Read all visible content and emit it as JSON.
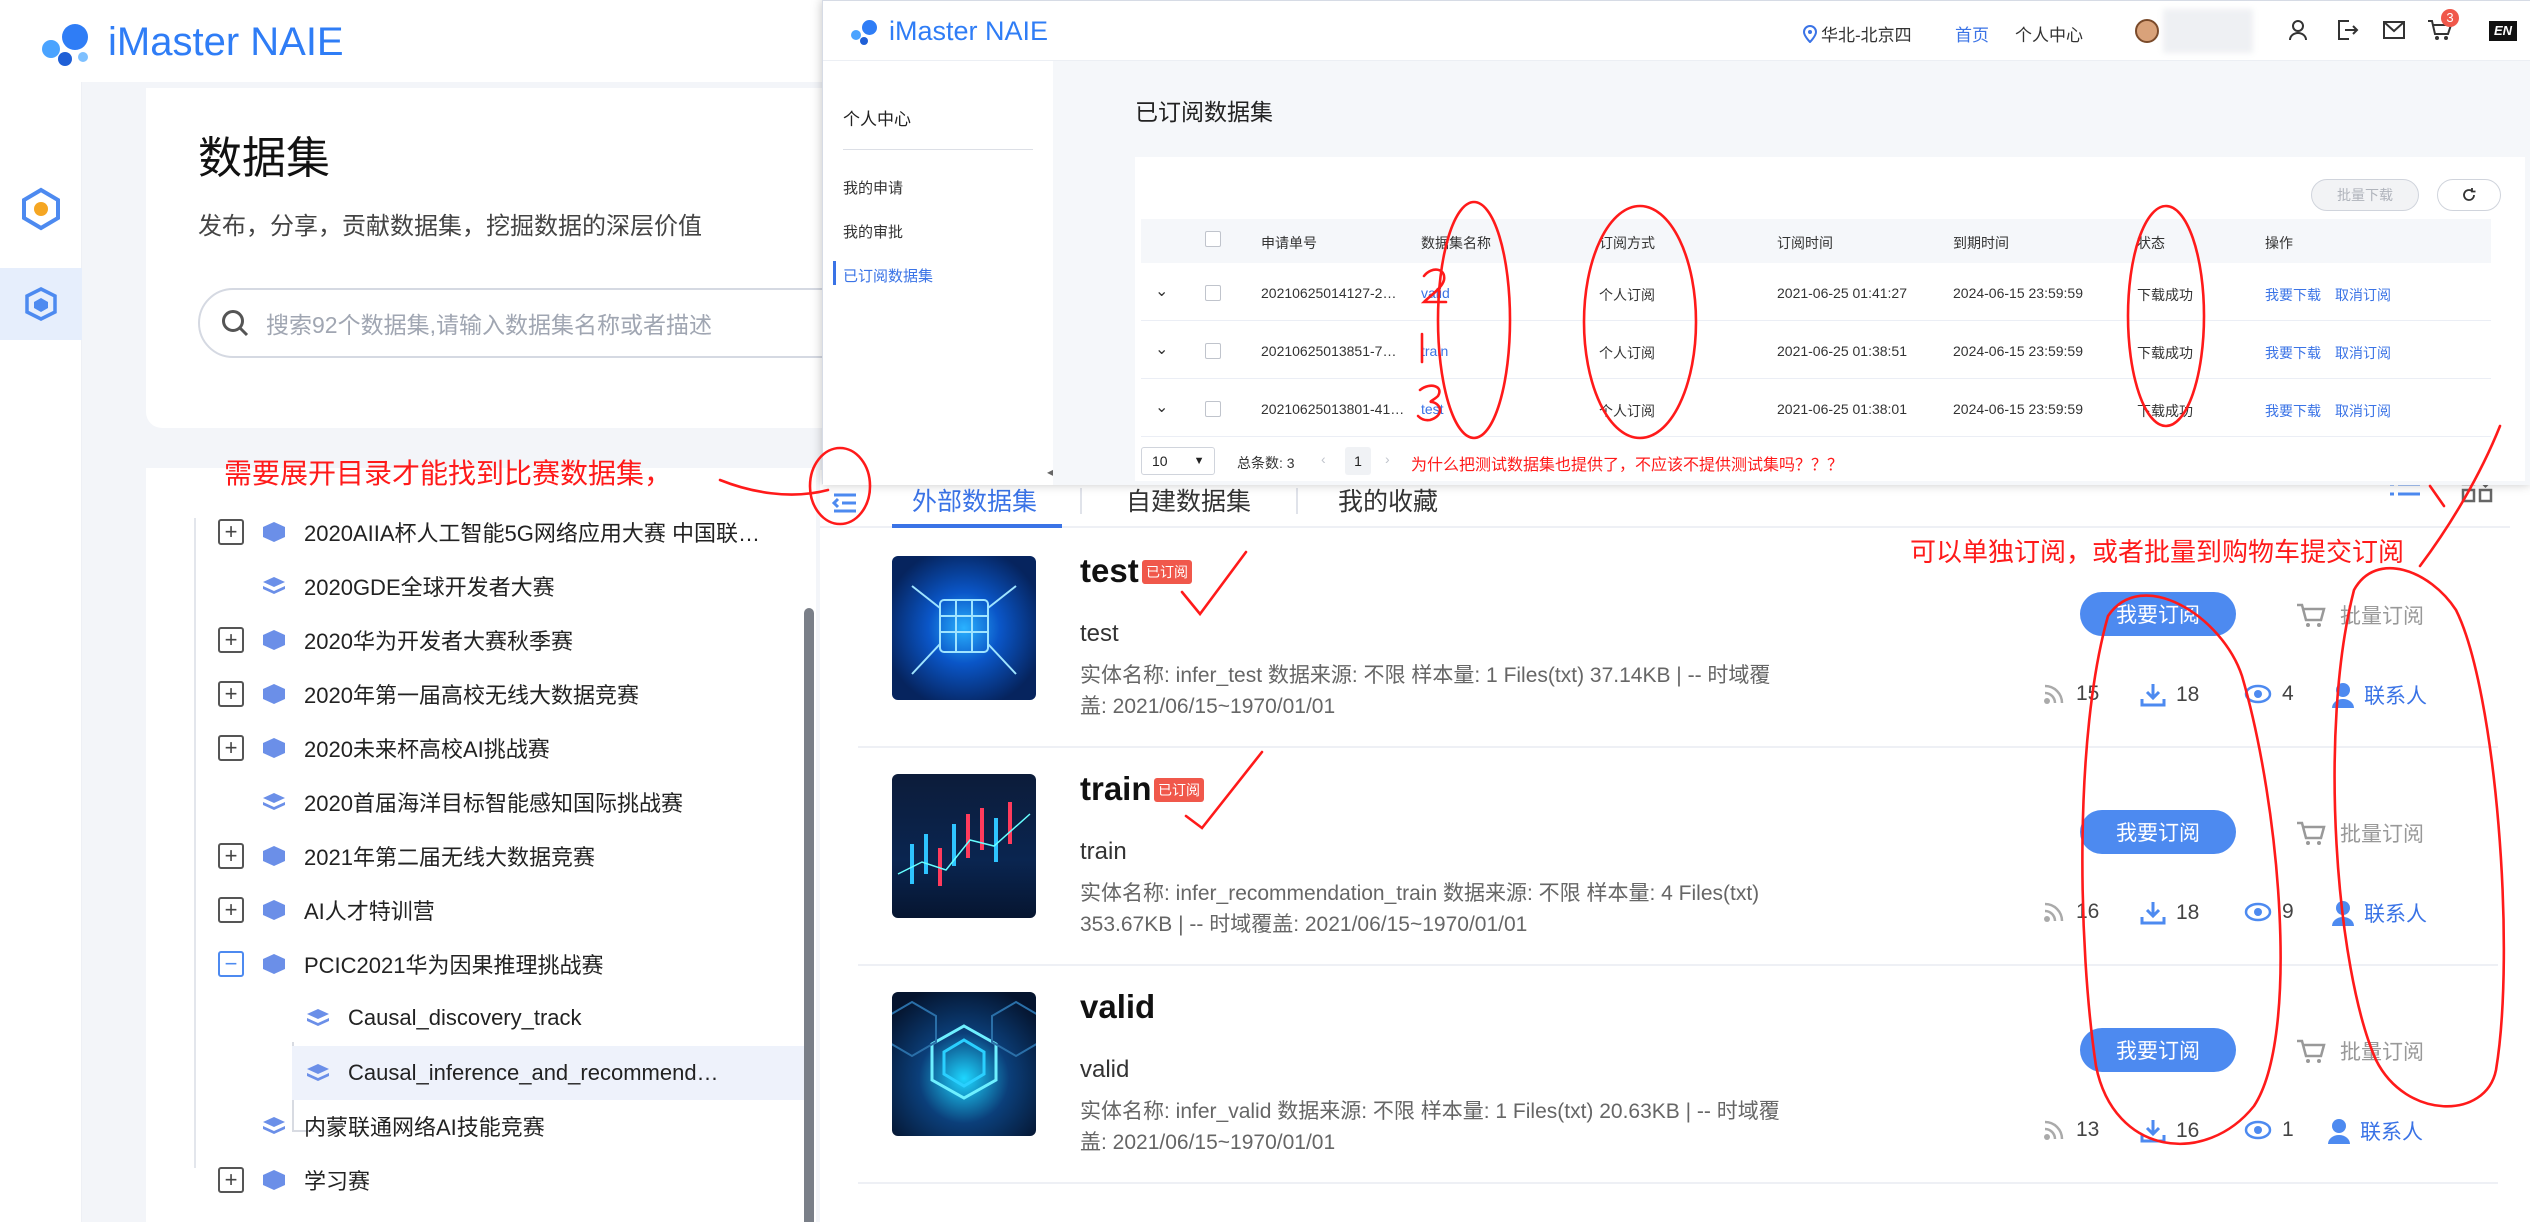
{
  "app": {
    "name": "iMaster NAIE"
  },
  "hero": {
    "title": "数据集",
    "subtitle": "发布，分享，贡献数据集，挖掘数据的深层价值",
    "search_placeholder": "搜索92个数据集,请输入数据集名称或者描述"
  },
  "tree": [
    {
      "label": "2020AIIA杯人工智能5G网络应用大赛 中国联…",
      "expand": "+"
    },
    {
      "label": "2020GDE全球开发者大赛",
      "expand": ""
    },
    {
      "label": "2020华为开发者大赛秋季赛",
      "expand": "+"
    },
    {
      "label": "2020年第一届高校无线大数据竞赛",
      "expand": "+"
    },
    {
      "label": "2020未来杯高校AI挑战赛",
      "expand": "+"
    },
    {
      "label": "2020首届海洋目标智能感知国际挑战赛",
      "expand": ""
    },
    {
      "label": "2021年第二届无线大数据竞赛",
      "expand": "+"
    },
    {
      "label": "AI人才特训营",
      "expand": "+"
    },
    {
      "label": "PCIC2021华为因果推理挑战赛",
      "expand": "−"
    },
    {
      "label": "Causal_discovery_track",
      "expand": ""
    },
    {
      "label": "Causal_inference_and_recommend…",
      "expand": ""
    },
    {
      "label": "内蒙联通网络AI技能竞赛",
      "expand": ""
    },
    {
      "label": "学习赛",
      "expand": "+"
    }
  ],
  "tabs": [
    "外部数据集",
    "自建数据集",
    "我的收藏"
  ],
  "datasets": [
    {
      "title": "test",
      "badge": "已订阅",
      "sub": "test",
      "meta1": "实体名称:  infer_test      数据来源:  不限       样本量:  1 Files(txt) 37.14KB  |  -- 时域覆",
      "meta2": "盖:  2021/06/15~1970/01/01",
      "subscribe": "我要订阅",
      "cart": "批量订阅",
      "views": "15",
      "downloads": "18",
      "eyes": "4",
      "contact": "联系人"
    },
    {
      "title": "train",
      "badge": "已订阅",
      "sub": "train",
      "meta1": "实体名称:  infer_recommendation_train      数据来源:  不限       样本量:  4 Files(txt)",
      "meta2": "353.67KB  |  -- 时域覆盖:  2021/06/15~1970/01/01",
      "subscribe": "我要订阅",
      "cart": "批量订阅",
      "views": "16",
      "downloads": "18",
      "eyes": "9",
      "contact": "联系人"
    },
    {
      "title": "valid",
      "badge": "",
      "sub": "valid",
      "meta1": "实体名称:  infer_valid      数据来源:  不限       样本量:  1 Files(txt) 20.63KB  |  -- 时域覆",
      "meta2": "盖:  2021/06/15~1970/01/01",
      "subscribe": "我要订阅",
      "cart": "批量订阅",
      "views": "13",
      "downloads": "16",
      "eyes": "1",
      "contact": "联系人"
    }
  ],
  "overlay": {
    "location": "华北-北京四",
    "nav_home": "首页",
    "nav_center": "个人中心",
    "cart_count": "3",
    "lang": "EN",
    "left_title": "个人中心",
    "left_items": [
      "我的申请",
      "我的审批",
      "已订阅数据集"
    ],
    "page_title": "已订阅数据集",
    "batch_download": "批量下载",
    "headers": [
      "申请单号",
      "数据集名称",
      "订阅方式",
      "订阅时间",
      "到期时间",
      "状态",
      "操作"
    ],
    "rows": [
      {
        "id": "20210625014127-2…",
        "name": "valid",
        "mode": "个人订阅",
        "time": "2021-06-25 01:41:27",
        "expire": "2024-06-15 23:59:59",
        "status": "下载成功",
        "op1": "我要下载",
        "op2": "取消订阅"
      },
      {
        "id": "20210625013851-7…",
        "name": "train",
        "mode": "个人订阅",
        "time": "2021-06-25 01:38:51",
        "expire": "2024-06-15 23:59:59",
        "status": "下载成功",
        "op1": "我要下载",
        "op2": "取消订阅"
      },
      {
        "id": "20210625013801-41…",
        "name": "test",
        "mode": "个人订阅",
        "time": "2021-06-25 01:38:01",
        "expire": "2024-06-15 23:59:59",
        "status": "下载成功",
        "op1": "我要下载",
        "op2": "取消订阅"
      }
    ],
    "page_size": "10",
    "total": "总条数: 3",
    "page": "1"
  },
  "annotations": {
    "note_question": "为什么把测试数据集也提供了，不应该不提供测试集吗？？？",
    "note_expand": "需要展开目录才能找到比赛数据集，",
    "note_subscribe": "可以单独订阅，或者批量到购物车提交订阅"
  },
  "colors": {
    "brand": "#2f7df6",
    "accent": "#4d8af0",
    "annotation": "#ff1a1a",
    "badge": "#f0584b"
  }
}
